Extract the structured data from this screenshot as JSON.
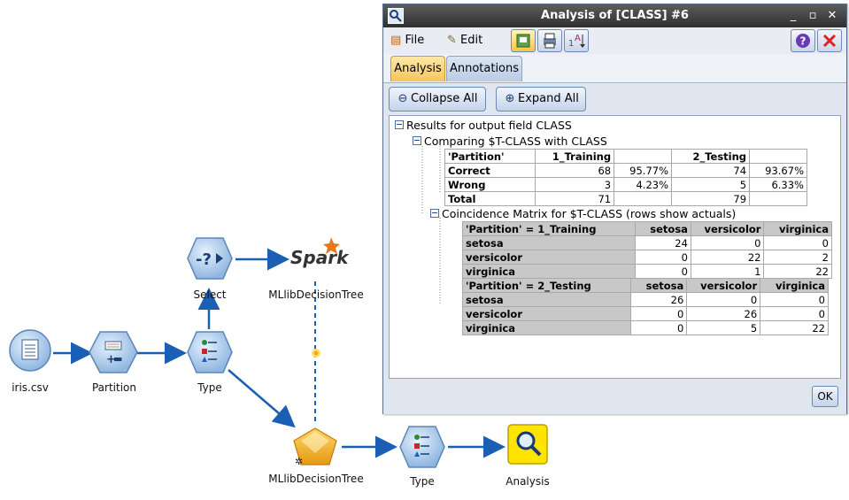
{
  "stream": {
    "nodes": {
      "iris": {
        "label": "iris.csv"
      },
      "partition": {
        "label": "Partition"
      },
      "type1": {
        "label": "Type"
      },
      "select": {
        "label": "Select"
      },
      "spark": {
        "label": "MLlibDecisionTree",
        "logo_text": "Spark"
      },
      "model": {
        "label": "MLlibDecisionTree"
      },
      "type2": {
        "label": "Type"
      },
      "analysis": {
        "label": "Analysis"
      }
    }
  },
  "dialog": {
    "title": "Analysis of [CLASS] #6",
    "menu": {
      "file": "File",
      "edit": "Edit"
    },
    "tabs": [
      {
        "label": "Analysis"
      },
      {
        "label": "Annotations"
      }
    ],
    "collapse_all": "Collapse All",
    "expand_all": "Expand All",
    "ok": "OK",
    "tree": {
      "root": "Results for output field CLASS",
      "comparing": "Comparing $T-CLASS with CLASS",
      "comparison_table": {
        "header": [
          "'Partition'",
          "1_Training",
          "",
          "2_Testing",
          ""
        ],
        "rows": [
          [
            "Correct",
            "68",
            "95.77%",
            "74",
            "93.67%"
          ],
          [
            "Wrong",
            "3",
            "4.23%",
            "5",
            "6.33%"
          ],
          [
            "Total",
            "71",
            "",
            "79",
            ""
          ]
        ]
      },
      "coincidence": "Coincidence Matrix for $T-CLASS (rows show actuals)",
      "matrix_training": {
        "header": [
          "'Partition' = 1_Training",
          "setosa",
          "versicolor",
          "virginica"
        ],
        "rows": [
          [
            "setosa",
            "24",
            "0",
            "0"
          ],
          [
            "versicolor",
            "0",
            "22",
            "2"
          ],
          [
            "virginica",
            "0",
            "1",
            "22"
          ]
        ]
      },
      "matrix_testing": {
        "header": [
          "'Partition' = 2_Testing",
          "setosa",
          "versicolor",
          "virginica"
        ],
        "rows": [
          [
            "setosa",
            "26",
            "0",
            "0"
          ],
          [
            "versicolor",
            "0",
            "26",
            "0"
          ],
          [
            "virginica",
            "0",
            "5",
            "22"
          ]
        ]
      }
    }
  },
  "colors": {
    "link": "#1a5fb4",
    "node_fill": "#b7d3f0",
    "model_gold": "#f5b422",
    "titlebar": "#3a3a3a"
  }
}
